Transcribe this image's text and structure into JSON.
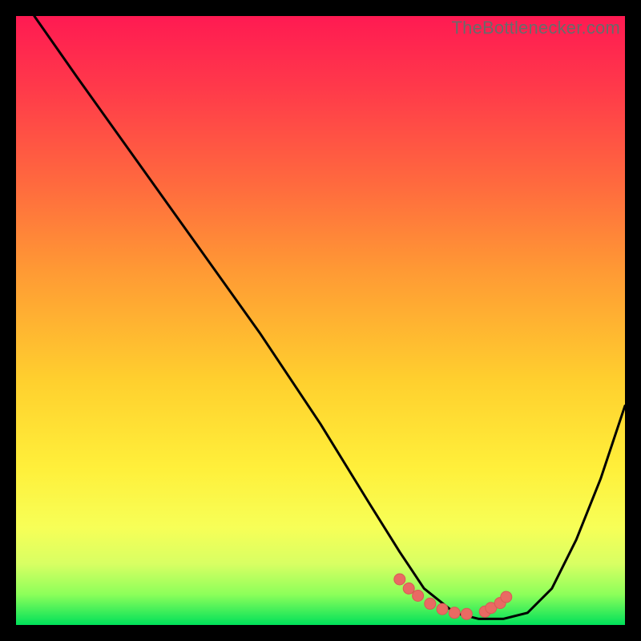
{
  "attribution": "TheBottleneсker.com",
  "chart_data": {
    "type": "line",
    "title": "",
    "xlabel": "",
    "ylabel": "",
    "xlim": [
      0,
      100
    ],
    "ylim": [
      0,
      100
    ],
    "series": [
      {
        "name": "bottleneck-curve",
        "x": [
          3,
          10,
          20,
          30,
          40,
          50,
          58,
          63,
          67,
          72,
          76,
          80,
          84,
          88,
          92,
          96,
          100
        ],
        "y": [
          100,
          90,
          76,
          62,
          48,
          33,
          20,
          12,
          6,
          2,
          1,
          1,
          2,
          6,
          14,
          24,
          36
        ]
      }
    ],
    "markers": {
      "name": "highlighted-points",
      "x": [
        63,
        64.5,
        66,
        68,
        70,
        72,
        74,
        77,
        78,
        79.5,
        80.5
      ],
      "y": [
        7.5,
        6.0,
        4.8,
        3.5,
        2.6,
        2.0,
        1.8,
        2.2,
        2.8,
        3.6,
        4.6
      ]
    },
    "colors": {
      "curve": "#000000",
      "marker": "#e96a63",
      "gradient_top": "#ff1a52",
      "gradient_bottom": "#00e05a"
    }
  }
}
